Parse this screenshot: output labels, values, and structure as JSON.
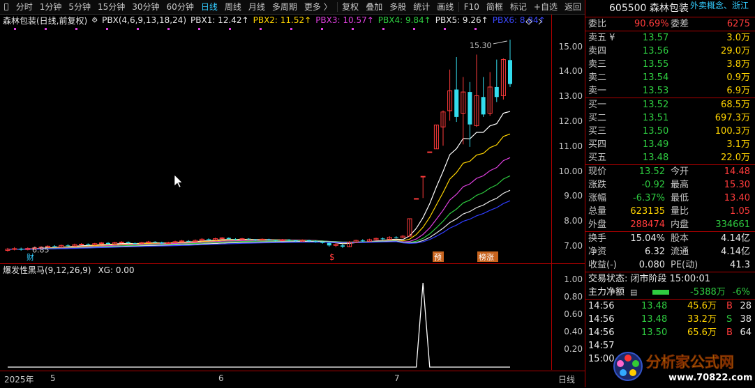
{
  "toolbar": {
    "items": [
      "分时",
      "1分钟",
      "5分钟",
      "15分钟",
      "30分钟",
      "60分钟",
      "日线",
      "周线",
      "月线",
      "多周期",
      "更多 〉",
      "复权",
      "叠加",
      "多股",
      "统计",
      "画线",
      "F10",
      "简框",
      "标记",
      "+自选",
      "返回"
    ],
    "active": "日线"
  },
  "main_header": {
    "stock": "森林包装(日线,前复权)",
    "indicator": "PBX(4,6,9,13,18,24)",
    "pbx1": "PBX1: 12.42↑",
    "pbx2": "PBX2: 11.52↑",
    "pbx3": "PBX3: 10.57↑",
    "pbx4": "PBX4: 9.84↑",
    "pbx5": "PBX5: 9.26↑",
    "pbx6": "PBX6: 8.84↑"
  },
  "sub_header": {
    "indicator": "爆发性黑马(9,12,26,9)",
    "xg": "XG: 0.00"
  },
  "price_axis": [
    "15.00",
    "14.00",
    "13.00",
    "12.00",
    "11.00",
    "10.00",
    "9.00",
    "8.00",
    "7.00"
  ],
  "sub_axis": [
    "1.00",
    "0.80",
    "0.60",
    "0.40",
    "0.20"
  ],
  "x_axis": {
    "year": "2025年",
    "m5": "5",
    "m6": "6",
    "m7": "7",
    "period": "日线"
  },
  "annotations": {
    "high": "15.30",
    "low": "6.85",
    "cai": "财",
    "dollar": "$",
    "yu": "预",
    "bang": "榜涨"
  },
  "colors": {
    "pbx1": "#ffffff",
    "pbx2": "#ffd400",
    "pbx3": "#e040e0",
    "pbx4": "#2ecc40",
    "pbx5": "#e8e8e8",
    "pbx6": "#2f3cff",
    "up": "#ff3b3b",
    "down": "#33ddee",
    "accent": "#33ccff"
  },
  "quote": {
    "title": "605500 森林包装",
    "concept": "外卖概念、浙江",
    "weibi_label": "委比",
    "weibi": "90.69%",
    "weicha_label": "委差",
    "weicha": "6275",
    "sell": [
      {
        "label": "卖五 ¥",
        "price": "13.57",
        "vol": "3.0万"
      },
      {
        "label": "卖四",
        "price": "13.56",
        "vol": "29.0万"
      },
      {
        "label": "卖三",
        "price": "13.55",
        "vol": "3.8万"
      },
      {
        "label": "卖二",
        "price": "13.54",
        "vol": "0.9万"
      },
      {
        "label": "卖一",
        "price": "13.53",
        "vol": "6.9万"
      }
    ],
    "buy": [
      {
        "label": "买一",
        "price": "13.52",
        "vol": "68.5万"
      },
      {
        "label": "买二",
        "price": "13.51",
        "vol": "697.3万"
      },
      {
        "label": "买三",
        "price": "13.50",
        "vol": "100.3万"
      },
      {
        "label": "买四",
        "price": "13.49",
        "vol": "3.1万"
      },
      {
        "label": "买五",
        "price": "13.48",
        "vol": "22.0万"
      }
    ],
    "stats": [
      {
        "l1": "现价",
        "v1": "13.52",
        "c1": "green",
        "l2": "今开",
        "v2": "14.48",
        "c2": "red"
      },
      {
        "l1": "涨跌",
        "v1": "-0.92",
        "c1": "green",
        "l2": "最高",
        "v2": "15.30",
        "c2": "red"
      },
      {
        "l1": "涨幅",
        "v1": "-6.37%",
        "c1": "green",
        "l2": "最低",
        "v2": "13.40",
        "c2": "red"
      },
      {
        "l1": "总量",
        "v1": "623135",
        "c1": "yellow",
        "l2": "量比",
        "v2": "1.05",
        "c2": "red"
      },
      {
        "l1": "外盘",
        "v1": "288474",
        "c1": "red",
        "l2": "内盘",
        "v2": "334661",
        "c2": "green"
      }
    ],
    "stats2": [
      {
        "l1": "换手",
        "v1": "15.04%",
        "l2": "股本",
        "v2": "4.14亿"
      },
      {
        "l1": "净资",
        "v1": "6.32",
        "l2": "流通",
        "v2": "4.14亿"
      },
      {
        "l1": "收益(-)",
        "v1": "0.080",
        "l2": "PE(动)",
        "v2": "41.3"
      }
    ],
    "status": "交易状态: 闭市阶段 15:00:01",
    "net_label": "主力净额",
    "net_value": "-5388万",
    "net_pct": "-6%",
    "ticks": [
      {
        "time": "14:56",
        "price": "13.48",
        "vol": "45.6万",
        "bs": "B",
        "n": "28"
      },
      {
        "time": "14:56",
        "price": "13.48",
        "vol": "33.2万",
        "bs": "S",
        "n": "38"
      },
      {
        "time": "14:56",
        "price": "13.50",
        "vol": "65.6万",
        "bs": "B",
        "n": "64"
      },
      {
        "time": "14:57",
        "price": "",
        "vol": "",
        "bs": "",
        "n": ""
      },
      {
        "time": "15:00",
        "price": "",
        "vol": "",
        "bs": "",
        "n": ""
      }
    ]
  },
  "logo": {
    "text": "分析家公式网",
    "url": "www.70822.com"
  },
  "chart_data": [
    {
      "type": "candlestick",
      "y_range": [
        6.5,
        15.8
      ],
      "candles": [
        [
          6.85,
          6.9,
          6.95,
          6.8
        ],
        [
          6.9,
          6.92,
          6.98,
          6.85
        ],
        [
          6.92,
          6.88,
          6.96,
          6.84
        ],
        [
          6.88,
          6.93,
          6.97,
          6.85
        ],
        [
          6.93,
          6.95,
          7.0,
          6.9
        ],
        [
          6.95,
          6.98,
          7.02,
          6.92
        ],
        [
          6.98,
          7.02,
          7.05,
          6.95
        ],
        [
          7.02,
          6.99,
          7.06,
          6.96
        ],
        [
          6.99,
          7.05,
          7.08,
          6.97
        ],
        [
          7.05,
          7.03,
          7.1,
          7.0
        ],
        [
          7.03,
          7.08,
          7.12,
          7.01
        ],
        [
          7.08,
          7.1,
          7.14,
          7.05
        ],
        [
          7.1,
          7.07,
          7.13,
          7.04
        ],
        [
          7.07,
          7.12,
          7.15,
          7.05
        ],
        [
          7.12,
          7.15,
          7.18,
          7.09
        ],
        [
          7.15,
          7.11,
          7.18,
          7.08
        ],
        [
          7.11,
          7.16,
          7.19,
          7.09
        ],
        [
          7.16,
          7.18,
          7.22,
          7.13
        ],
        [
          7.18,
          7.14,
          7.21,
          7.11
        ],
        [
          7.14,
          7.12,
          7.17,
          7.09
        ],
        [
          7.12,
          7.16,
          7.19,
          7.1
        ],
        [
          7.16,
          7.19,
          7.23,
          7.14
        ],
        [
          7.19,
          7.17,
          7.22,
          7.14
        ],
        [
          7.17,
          7.13,
          7.2,
          7.1
        ],
        [
          7.13,
          7.16,
          7.19,
          7.1
        ],
        [
          7.16,
          7.2,
          7.24,
          7.14
        ],
        [
          7.2,
          7.23,
          7.27,
          7.18
        ],
        [
          7.23,
          7.21,
          7.26,
          7.18
        ],
        [
          7.21,
          7.25,
          7.29,
          7.19
        ],
        [
          7.25,
          7.3,
          7.34,
          7.22
        ],
        [
          7.3,
          7.27,
          7.33,
          7.24
        ],
        [
          7.27,
          7.32,
          7.36,
          7.25
        ],
        [
          7.32,
          7.35,
          7.38,
          7.29
        ],
        [
          7.35,
          7.31,
          7.37,
          7.28
        ],
        [
          7.31,
          7.28,
          7.34,
          7.25
        ],
        [
          7.28,
          7.32,
          7.35,
          7.26
        ],
        [
          7.32,
          7.29,
          7.34,
          7.26
        ],
        [
          7.29,
          7.26,
          7.31,
          7.23
        ],
        [
          7.26,
          7.3,
          7.33,
          7.24
        ],
        [
          7.3,
          7.27,
          7.32,
          7.24
        ],
        [
          7.27,
          7.24,
          7.29,
          7.21
        ],
        [
          7.24,
          7.28,
          7.31,
          7.22
        ],
        [
          7.28,
          7.25,
          7.3,
          7.22
        ],
        [
          7.25,
          7.22,
          7.27,
          7.19
        ],
        [
          7.22,
          7.26,
          7.29,
          7.2
        ],
        [
          7.26,
          7.22,
          7.28,
          7.18
        ],
        [
          7.22,
          7.19,
          7.25,
          7.16
        ],
        [
          7.19,
          7.15,
          7.21,
          7.12
        ],
        [
          7.15,
          7.05,
          7.17,
          7.0
        ],
        [
          7.05,
          7.1,
          7.15,
          6.98
        ],
        [
          7.05,
          7.0,
          7.1,
          6.95
        ],
        [
          7.0,
          7.18,
          7.22,
          6.98
        ],
        [
          7.18,
          7.25,
          7.28,
          7.15
        ],
        [
          7.25,
          7.22,
          7.3,
          7.18
        ],
        [
          7.22,
          7.28,
          7.32,
          7.2
        ],
        [
          7.28,
          7.33,
          7.36,
          7.25
        ],
        [
          7.33,
          7.3,
          7.37,
          7.27
        ],
        [
          7.3,
          7.38,
          7.42,
          7.28
        ],
        [
          7.38,
          7.36,
          7.42,
          7.33
        ],
        [
          7.36,
          7.42,
          7.46,
          7.34
        ],
        [
          7.42,
          8.12,
          8.13,
          7.4
        ],
        [
          8.93,
          8.93,
          8.93,
          8.93
        ],
        [
          9.82,
          9.82,
          9.82,
          8.95
        ],
        [
          10.8,
          10.8,
          10.8,
          10.8
        ],
        [
          10.92,
          11.88,
          11.88,
          10.92
        ],
        [
          11.8,
          12.4,
          12.46,
          11.05
        ],
        [
          12.45,
          13.25,
          14.1,
          12.05
        ],
        [
          13.3,
          12.2,
          14.6,
          12.0
        ],
        [
          12.35,
          13.2,
          13.8,
          11.1
        ],
        [
          13.2,
          11.9,
          13.6,
          11.0
        ],
        [
          11.85,
          13.05,
          14.7,
          11.8
        ],
        [
          13.0,
          12.3,
          13.8,
          12.2
        ],
        [
          12.35,
          13.4,
          14.0,
          12.25
        ],
        [
          13.4,
          13.0,
          14.5,
          12.8
        ],
        [
          13.05,
          14.5,
          14.55,
          12.9
        ],
        [
          14.48,
          13.52,
          15.3,
          13.4
        ]
      ],
      "pbx_end": [
        12.42,
        11.52,
        10.57,
        9.84,
        9.26,
        8.84
      ]
    },
    {
      "type": "line",
      "name": "XG",
      "y_range": [
        0,
        1.05
      ],
      "spike_index": 62,
      "spike_value": 1.0
    }
  ]
}
